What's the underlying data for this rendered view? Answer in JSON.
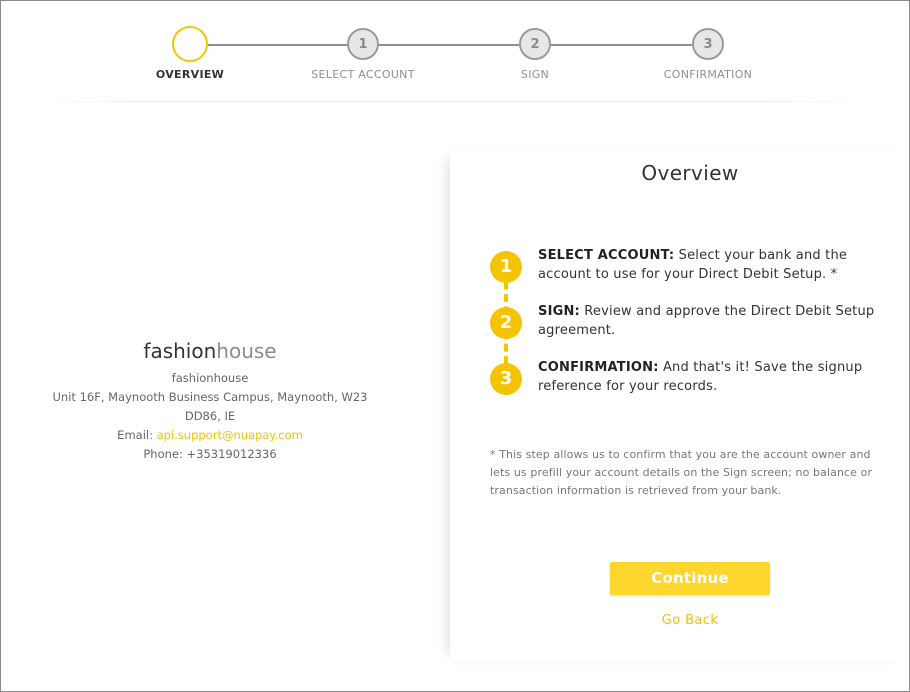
{
  "stepper": {
    "steps": [
      {
        "number": "",
        "label": "OVERVIEW",
        "active": true
      },
      {
        "number": "1",
        "label": "SELECT ACCOUNT",
        "active": false
      },
      {
        "number": "2",
        "label": "SIGN",
        "active": false
      },
      {
        "number": "3",
        "label": "CONFIRMATION",
        "active": false
      }
    ]
  },
  "merchant": {
    "logo_part1": "fashion",
    "logo_part2": "house",
    "name": "fashionhouse",
    "address": "Unit 16F, Maynooth Business Campus, Maynooth, W23 DD86, IE",
    "email_label": "Email: ",
    "email": "api.support@nuapay.com",
    "phone": "Phone: +35319012336"
  },
  "overview": {
    "title": "Overview",
    "steps": [
      {
        "number": "1",
        "heading": "SELECT ACCOUNT:",
        "text": " Select your bank and the account to use for your Direct Debit Setup. *"
      },
      {
        "number": "2",
        "heading": "SIGN:",
        "text": " Review and approve the Direct Debit Setup agreement."
      },
      {
        "number": "3",
        "heading": "CONFIRMATION:",
        "text": " And that's it! Save the signup reference for your records."
      }
    ],
    "footnote": "* This step allows us to confirm that you are the account owner and lets us prefill your account details on the Sign screen; no balance or transaction information is retrieved from your bank.",
    "continue_label": "Continue",
    "goback_label": "Go Back"
  },
  "colors": {
    "accent": "#f5c400",
    "button": "#fdd62e",
    "step_inactive": "#e7e7e7"
  }
}
